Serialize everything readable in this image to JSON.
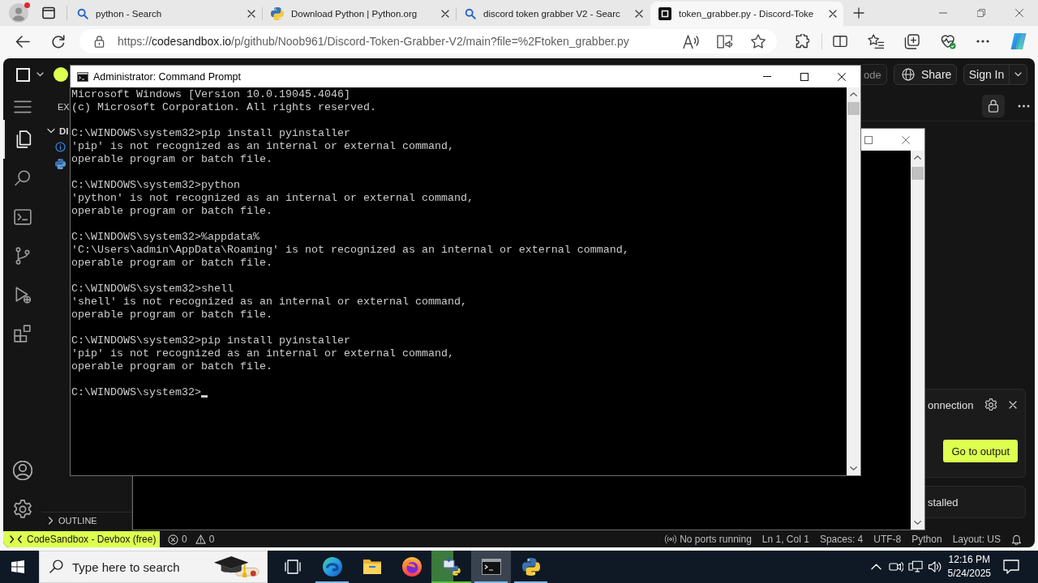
{
  "browser": {
    "profile_notification": true,
    "tabs": [
      {
        "kind": "search",
        "title": "python - Search",
        "selected": false
      },
      {
        "kind": "python",
        "title": "Download Python | Python.org",
        "selected": false
      },
      {
        "kind": "search",
        "title": "discord token grabber V2 - Searc",
        "selected": false
      },
      {
        "kind": "sandbox",
        "title": "token_grabber.py - Discord-Toke",
        "selected": true
      }
    ],
    "url": [
      {
        "text": "https://",
        "emphasis": false
      },
      {
        "text": "codesandbox.io",
        "emphasis": true
      },
      {
        "text": "/p/github/Noob961/Discord-Token-Grabber-V2/main?file=%2Ftoken_grabber.py",
        "emphasis": false
      }
    ]
  },
  "codesandbox": {
    "top_buttons": [
      {
        "kind": "plain",
        "label": "ode"
      },
      {
        "kind": "share",
        "label": "Share"
      },
      {
        "kind": "split",
        "label": "Sign In"
      }
    ],
    "activity_bar": [
      {
        "kind": "menu",
        "selected": false
      },
      {
        "kind": "files",
        "selected": true
      },
      {
        "kind": "search",
        "selected": false
      },
      {
        "kind": "terminal",
        "selected": false
      },
      {
        "kind": "source-control",
        "selected": false
      },
      {
        "kind": "run",
        "selected": false
      },
      {
        "kind": "extensions",
        "selected": false
      }
    ],
    "activity_bar_bottom": [
      {
        "kind": "account"
      },
      {
        "kind": "settings"
      }
    ],
    "explorer": {
      "title": "EX",
      "folder": {
        "label": "DI",
        "expanded": true
      },
      "entries": [
        {
          "kind": "info"
        },
        {
          "kind": "python"
        }
      ],
      "outline": {
        "label": "OUTLINE",
        "expanded": false
      }
    },
    "notifications": [
      {
        "text": "onnection",
        "button": "Go to output"
      },
      {
        "text": "stalled"
      }
    ],
    "status_bar": {
      "remote": "CodeSandbox - Devbox (free)",
      "problems": [
        {
          "kind": "error",
          "count": "0"
        },
        {
          "kind": "warning",
          "count": "0"
        }
      ],
      "items": [
        {
          "kind": "ports",
          "text": "No ports running"
        },
        {
          "kind": "text",
          "text": "Ln 1, Col 1"
        },
        {
          "kind": "text",
          "text": "Spaces: 4"
        },
        {
          "kind": "text",
          "text": "UTF-8"
        },
        {
          "kind": "text",
          "text": "Python"
        },
        {
          "kind": "text",
          "text": "Layout: US"
        },
        {
          "kind": "bell"
        }
      ]
    }
  },
  "windows": [
    {
      "kind": "terminal",
      "title": "Administrator: Command Prompt",
      "blocks": [
        [
          "Microsoft Windows [Version 10.0.19045.4046]",
          "(c) Microsoft Corporation. All rights reserved."
        ],
        [
          "C:\\WINDOWS\\system32>pip install pyinstaller",
          "'pip' is not recognized as an internal or external command,",
          "operable program or batch file."
        ],
        [
          "C:\\WINDOWS\\system32>python",
          "'python' is not recognized as an internal or external command,",
          "operable program or batch file."
        ],
        [
          "C:\\WINDOWS\\system32>%appdata%",
          "'C:\\Users\\admin\\AppData\\Roaming' is not recognized as an internal or external command,",
          "operable program or batch file."
        ],
        [
          "C:\\WINDOWS\\system32>shell",
          "'shell' is not recognized as an internal or external command,",
          "operable program or batch file."
        ],
        [
          "C:\\WINDOWS\\system32>pip install pyinstaller",
          "'pip' is not recognized as an internal or external command,",
          "operable program or batch file."
        ]
      ],
      "prompt": "C:\\WINDOWS\\system32>"
    },
    {
      "kind": "covered"
    }
  ],
  "taskbar": {
    "search_placeholder": "Type here to search",
    "apps": [
      {
        "kind": "task-view",
        "running": false,
        "active": false
      },
      {
        "kind": "browser",
        "running": true,
        "active": false
      },
      {
        "kind": "folder",
        "running": false,
        "active": false
      },
      {
        "kind": "firefox",
        "running": false,
        "active": false
      },
      {
        "kind": "installer",
        "running": true,
        "active": false,
        "level": 0.55
      },
      {
        "kind": "console",
        "running": true,
        "active": true
      },
      {
        "kind": "python",
        "running": true,
        "active": false
      }
    ],
    "time": "12:16 PM",
    "date": "5/24/2025"
  }
}
